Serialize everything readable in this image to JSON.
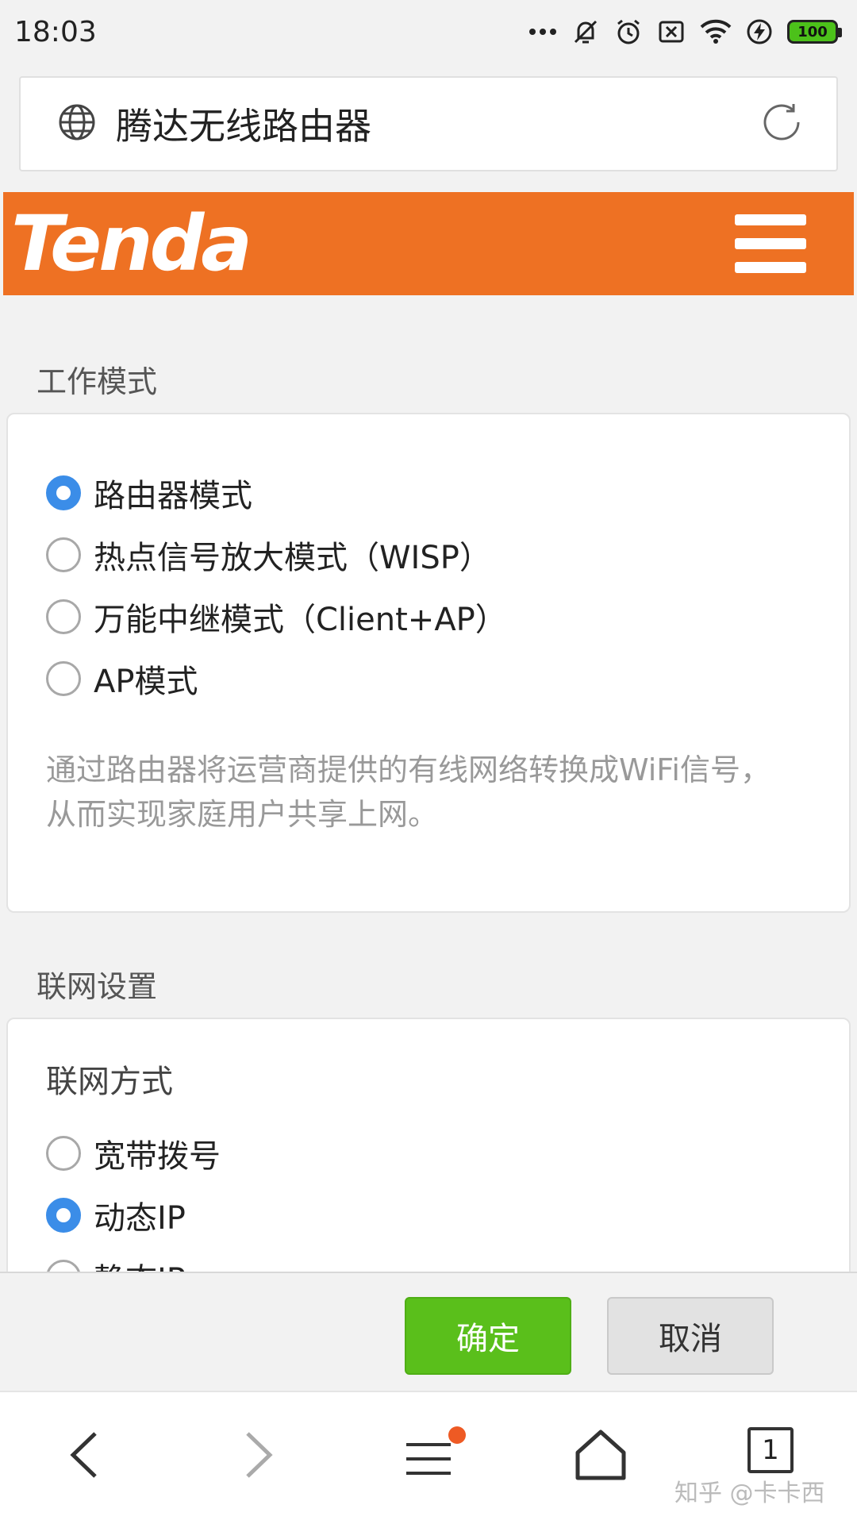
{
  "status_bar": {
    "time": "18:03",
    "battery": "100",
    "icons": [
      "more-dots-icon",
      "mute-icon",
      "alarm-icon",
      "sim-off-icon",
      "wifi-icon",
      "charging-icon",
      "battery-icon"
    ]
  },
  "address_bar": {
    "title": "腾达无线路由器",
    "icons": [
      "globe-icon",
      "refresh-icon"
    ]
  },
  "brand": {
    "logo_text": "Tenda",
    "color": "#ee7123"
  },
  "work_mode": {
    "title": "工作模式",
    "options": [
      {
        "label": "路由器模式",
        "checked": true
      },
      {
        "label": "热点信号放大模式（WISP）",
        "checked": false
      },
      {
        "label": "万能中继模式（Client+AP）",
        "checked": false
      },
      {
        "label": "AP模式",
        "checked": false
      }
    ],
    "description": "通过路由器将运营商提供的有线网络转换成WiFi信号，从而实现家庭用户共享上网。"
  },
  "network_settings": {
    "title": "联网设置",
    "method_label": "联网方式",
    "options": [
      {
        "label": "宽带拨号",
        "checked": false
      },
      {
        "label": "动态IP",
        "checked": true
      },
      {
        "label": "静态IP",
        "checked": false
      }
    ]
  },
  "actions": {
    "confirm": "确定",
    "cancel": "取消",
    "confirm_color": "#5abf1b"
  },
  "browser_nav": {
    "tab_count": "1",
    "watermark": "知乎 @卡卡西",
    "icons": [
      "back-icon",
      "forward-icon",
      "menu-icon",
      "home-icon",
      "tabs-icon"
    ]
  },
  "accent_color": "#3b8de8"
}
